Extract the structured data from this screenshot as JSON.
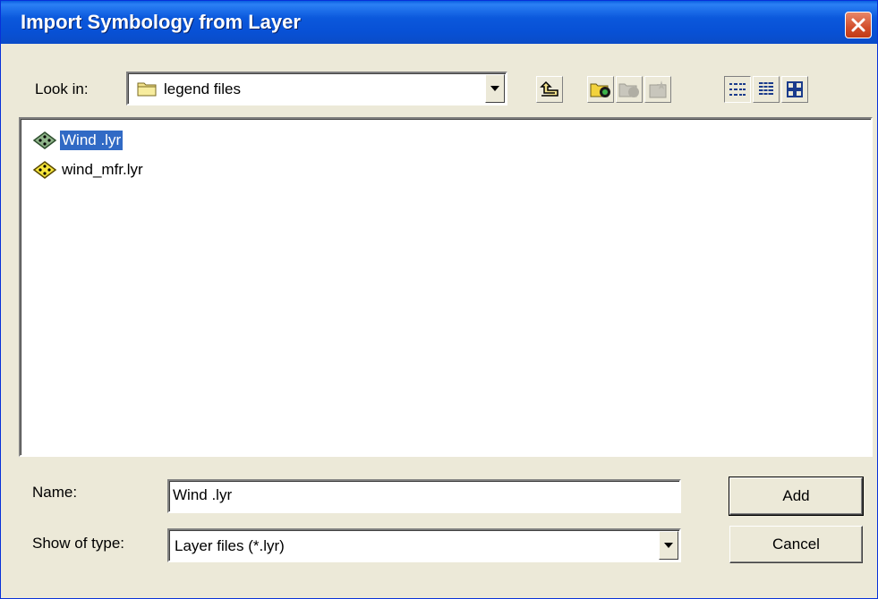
{
  "dialog": {
    "title": "Import Symbology from Layer"
  },
  "look_in": {
    "label": "Look in:",
    "value": "legend files"
  },
  "toolbar": {
    "icons": [
      "up-one-level-icon",
      "connect-folder-icon",
      "disconnect-folder-icon",
      "new-folder-icon",
      "list-view-icon",
      "details-view-icon",
      "thumbnails-view-icon"
    ]
  },
  "files": [
    {
      "name": "Wind .lyr",
      "icon": "layer-file-icon",
      "selected": true
    },
    {
      "name": "wind_mfr.lyr",
      "icon": "layer-file-icon",
      "selected": false
    }
  ],
  "name_field": {
    "label": "Name:",
    "value": "Wind .lyr"
  },
  "type_field": {
    "label": "Show of type:",
    "value": "Layer files (*.lyr)"
  },
  "buttons": {
    "add": "Add",
    "cancel": "Cancel"
  },
  "colors": {
    "titlebar": "#0a58dc",
    "selection": "#316ac5",
    "dialog_bg": "#ece9d8",
    "close_button": "#d24e2b"
  }
}
